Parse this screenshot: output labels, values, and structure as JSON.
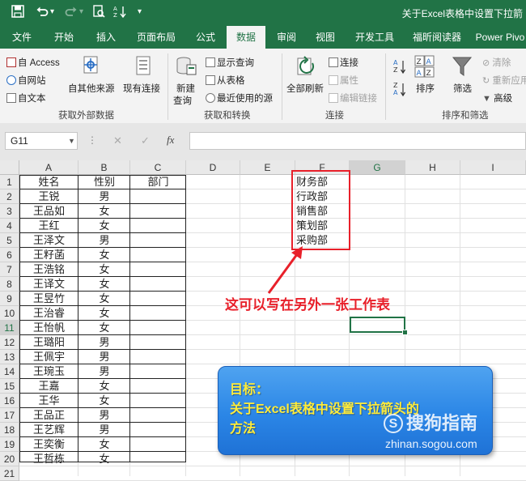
{
  "window": {
    "title": "关于Excel表格中设置下拉箭",
    "qa_dropdown_glyph": "▾"
  },
  "tabs": [
    "文件",
    "开始",
    "插入",
    "页面布局",
    "公式",
    "数据",
    "审阅",
    "视图",
    "开发工具",
    "福昕阅读器",
    "Power Pivo"
  ],
  "active_tab": "数据",
  "ribbon": {
    "get_external": {
      "access": "自 Access",
      "web": "自网站",
      "text": "自文本",
      "other_sources": "自其他来源",
      "existing_conn": "现有连接",
      "group_label": "获取外部数据"
    },
    "get_transform": {
      "new_query": "新建",
      "new_query2": "查询",
      "show_queries": "显示查询",
      "from_table": "从表格",
      "recent_sources": "最近使用的源",
      "group_label": "获取和转换"
    },
    "connections": {
      "refresh_all": "全部刷新",
      "connections": "连接",
      "properties": "属性",
      "edit_links": "编辑链接",
      "group_label": "连接"
    },
    "sort_filter": {
      "sort": "排序",
      "filter": "筛选",
      "clear": "清除",
      "reapply": "重新应用",
      "advanced": "高级",
      "group_label": "排序和筛选"
    }
  },
  "formula_bar": {
    "name_box": "G11",
    "cancel": "✕",
    "enter": "✓",
    "fx": "fx",
    "value": ""
  },
  "sheet": {
    "columns": [
      "A",
      "B",
      "C",
      "D",
      "E",
      "F",
      "G",
      "H",
      "I"
    ],
    "selected_column": "G",
    "selected_row": "11",
    "rows": [
      "1",
      "2",
      "3",
      "4",
      "5",
      "6",
      "7",
      "8",
      "9",
      "10",
      "11",
      "12",
      "13",
      "14",
      "15",
      "16",
      "17",
      "18",
      "19",
      "20",
      "21"
    ],
    "headers": {
      "a1": "姓名",
      "b1": "性别",
      "c1": "部门"
    },
    "names": [
      "王锐",
      "王品如",
      "王红",
      "王泽文",
      "王籽菡",
      "王浩铭",
      "王译文",
      "王昱竹",
      "王治睿",
      "王怡帆",
      "王璐阳",
      "王佩宇",
      "王琬玉",
      "王嘉",
      "王华",
      "王品正",
      "王艺辉",
      "王奕衡",
      "王哲栋"
    ],
    "genders": [
      "男",
      "女",
      "女",
      "男",
      "女",
      "女",
      "女",
      "女",
      "女",
      "女",
      "男",
      "男",
      "男",
      "女",
      "女",
      "男",
      "男",
      "女",
      "女"
    ],
    "departments": [
      "财务部",
      "行政部",
      "销售部",
      "策划部",
      "采购部"
    ]
  },
  "annotation": "这可以写在另外一张工作表",
  "goal_box": {
    "line1": "目标：",
    "line2": "关于Excel表格中设置下拉箭头的",
    "line3": "方法"
  },
  "watermark": {
    "brand": "搜狗指南",
    "url": "zhinan.sogou.com"
  },
  "colors": {
    "excel_green": "#217346",
    "annotation_red": "#e8202a",
    "goal_yellow": "#ffec3a"
  }
}
